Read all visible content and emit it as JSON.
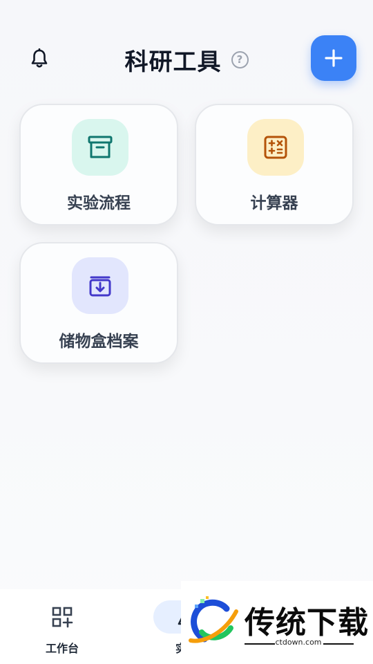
{
  "header": {
    "title": "科研工具",
    "help_label": "?"
  },
  "cards": [
    {
      "label": "实验流程",
      "icon": "archive-box-icon",
      "bg": "#d9f6ee",
      "color": "#0f766e"
    },
    {
      "label": "计算器",
      "icon": "calculator-icon",
      "bg": "#fdefc6",
      "color": "#b45309"
    },
    {
      "label": "储物盒档案",
      "icon": "archive-download-icon",
      "bg": "#e2e6fd",
      "color": "#4338ca"
    }
  ],
  "tabbar": {
    "tabs": [
      {
        "label": "工作台",
        "icon": "grid-add-icon"
      },
      {
        "label": "实验",
        "icon": "flask-icon",
        "active": true
      }
    ]
  },
  "watermark": {
    "text": "传统下载",
    "url": "ctdown.com"
  },
  "colors": {
    "accent": "#3b82f6"
  }
}
